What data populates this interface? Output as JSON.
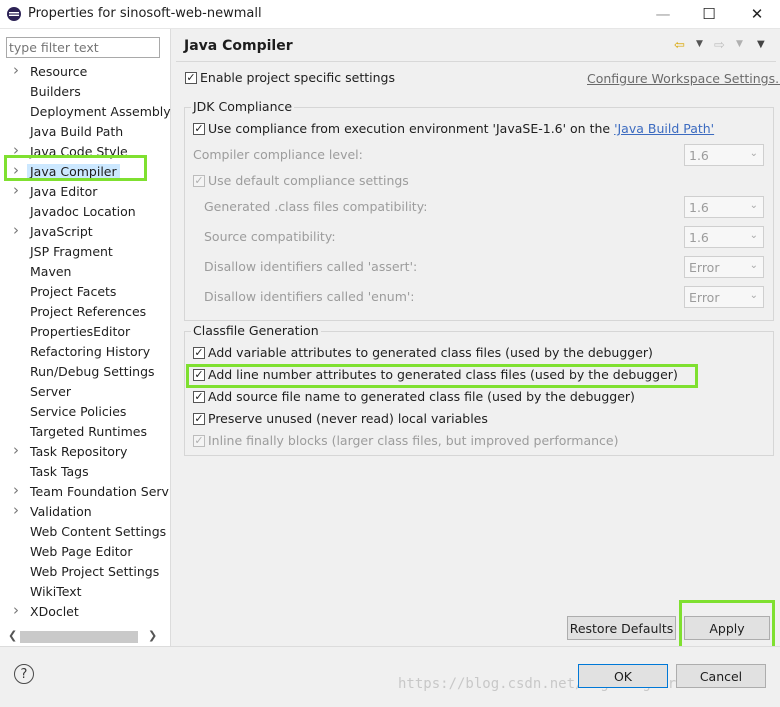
{
  "window": {
    "title": "Properties for sinosoft-web-newmall",
    "controls": {
      "minimize": "—",
      "maximize": "☐",
      "close": "✕"
    }
  },
  "filter": {
    "placeholder": "type filter text"
  },
  "tree": {
    "items": [
      {
        "label": "Resource",
        "expandable": true
      },
      {
        "label": "Builders",
        "expandable": false
      },
      {
        "label": "Deployment Assembly",
        "expandable": false
      },
      {
        "label": "Java Build Path",
        "expandable": false
      },
      {
        "label": "Java Code Style",
        "expandable": true
      },
      {
        "label": "Java Compiler",
        "expandable": true,
        "selected": true
      },
      {
        "label": "Java Editor",
        "expandable": true
      },
      {
        "label": "Javadoc Location",
        "expandable": false
      },
      {
        "label": "JavaScript",
        "expandable": true
      },
      {
        "label": "JSP Fragment",
        "expandable": false
      },
      {
        "label": "Maven",
        "expandable": false
      },
      {
        "label": "Project Facets",
        "expandable": false
      },
      {
        "label": "Project References",
        "expandable": false
      },
      {
        "label": "PropertiesEditor",
        "expandable": false
      },
      {
        "label": "Refactoring History",
        "expandable": false
      },
      {
        "label": "Run/Debug Settings",
        "expandable": false
      },
      {
        "label": "Server",
        "expandable": false
      },
      {
        "label": "Service Policies",
        "expandable": false
      },
      {
        "label": "Targeted Runtimes",
        "expandable": false
      },
      {
        "label": "Task Repository",
        "expandable": true
      },
      {
        "label": "Task Tags",
        "expandable": false
      },
      {
        "label": "Team Foundation Serv",
        "expandable": true
      },
      {
        "label": "Validation",
        "expandable": true
      },
      {
        "label": "Web Content Settings",
        "expandable": false
      },
      {
        "label": "Web Page Editor",
        "expandable": false
      },
      {
        "label": "Web Project Settings",
        "expandable": false
      },
      {
        "label": "WikiText",
        "expandable": false
      },
      {
        "label": "XDoclet",
        "expandable": true
      }
    ]
  },
  "page": {
    "title": "Java Compiler",
    "enable_project_settings": "Enable project specific settings",
    "configure_workspace_link": "Configure Workspace Settings..."
  },
  "jdk": {
    "group_title": "JDK Compliance",
    "use_compliance_prefix": "Use compliance from execution environment 'JavaSE-1.6' on the ",
    "use_compliance_link": "'Java Build Path'",
    "compiler_level_label": "Compiler compliance level:",
    "compiler_level_value": "1.6",
    "use_default_label": "Use default compliance settings",
    "generated_label": "Generated .class files compatibility:",
    "generated_value": "1.6",
    "source_label": "Source compatibility:",
    "source_value": "1.6",
    "assert_label": "Disallow identifiers called 'assert':",
    "assert_value": "Error",
    "enum_label": "Disallow identifiers called 'enum':",
    "enum_value": "Error"
  },
  "classfile": {
    "group_title": "Classfile Generation",
    "options": [
      {
        "label": "Add variable attributes to generated class files (used by the debugger)",
        "checked": true,
        "enabled": true
      },
      {
        "label": "Add line number attributes to generated class files (used by the debugger)",
        "checked": true,
        "enabled": true
      },
      {
        "label": "Add source file name to generated class file (used by the debugger)",
        "checked": true,
        "enabled": true
      },
      {
        "label": "Preserve unused (never read) local variables",
        "checked": true,
        "enabled": true
      },
      {
        "label": "Inline finally blocks (larger class files, but improved performance)",
        "checked": true,
        "enabled": false
      }
    ]
  },
  "buttons": {
    "restore_defaults": "Restore Defaults",
    "apply": "Apply",
    "ok": "OK",
    "cancel": "Cancel"
  },
  "help_icon": "?",
  "watermark": "https://blog.csdn.net/lightingFiranda",
  "colors": {
    "highlight": "#7fe030",
    "link": "#3c6bc0",
    "selection": "#cce8ff"
  }
}
